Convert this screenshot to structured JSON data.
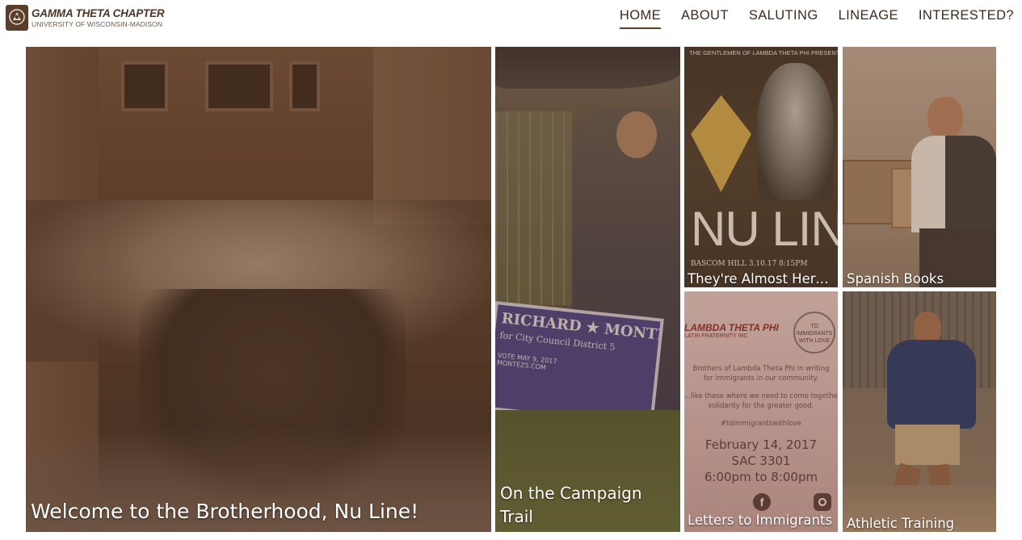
{
  "brand": {
    "title": "GAMMA THETA CHAPTER",
    "subtitle": "UNIVERSITY OF WISCONSIN-MADISON"
  },
  "nav": [
    {
      "label": "HOME",
      "active": true
    },
    {
      "label": "ABOUT",
      "active": false
    },
    {
      "label": "SALUTING",
      "active": false
    },
    {
      "label": "LINEAGE",
      "active": false
    },
    {
      "label": "INTERESTED?",
      "active": false
    }
  ],
  "tiles": [
    {
      "caption": "Welcome to the Brotherhood, Nu Line!"
    },
    {
      "caption": "On the Campaign Trail"
    },
    {
      "caption": "They're Almost Here..."
    },
    {
      "caption": "Spanish Books"
    },
    {
      "caption": "Letters to Immigrants"
    },
    {
      "caption": "Athletic Training"
    }
  ],
  "poster_nu_line": {
    "header": "THE GENTLEMEN OF LAMBDA THETA PHI PRESENT...",
    "title": "NU LINE",
    "footer": "BASCOM HILL  3.10.17  8:15PM"
  },
  "campaign_sign": {
    "name": "RICHARD ★ MONTEZ",
    "office": "for City Council District 5",
    "vote": "VOTE MAY 9, 2017",
    "site": "MONTEZ5.COM"
  },
  "poster_letters": {
    "org": "LAMBDA THETA PHI",
    "org_sub": "LATIN FRATERNITY INC",
    "badge": "TO IMMIGRANTS WITH LOVE",
    "line1": "Brothers of Lambda Theta Phi in writing",
    "line2": "for immigrants in our community.",
    "line3": "...like these where we need to come together",
    "line4": "solidarity for the greater good.",
    "hashtag": "#toimmigrantswithlove",
    "date": "February 14, 2017",
    "room": "SAC 3301",
    "time": "6:00pm to 8:00pm"
  },
  "colors": {
    "brand_brown": "#5a3e2b",
    "nav_text": "#3d2a1e",
    "caption_text": "#ffffff"
  }
}
